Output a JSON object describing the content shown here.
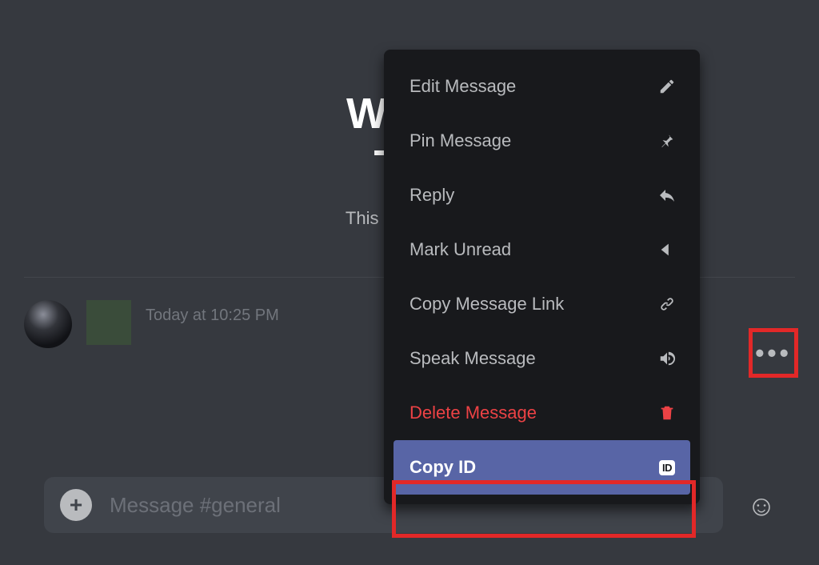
{
  "welcome": {
    "title_line1": "Welco",
    "title_line2": "Tes",
    "subtitle": "This is the begin"
  },
  "message": {
    "timestamp": "Today at 10:25 PM"
  },
  "composer": {
    "placeholder": "Message #general"
  },
  "menu": {
    "edit": "Edit Message",
    "pin": "Pin Message",
    "reply": "Reply",
    "mark_unread": "Mark Unread",
    "copy_link": "Copy Message Link",
    "speak": "Speak Message",
    "delete": "Delete Message",
    "copy_id": "Copy ID",
    "id_badge": "ID"
  }
}
